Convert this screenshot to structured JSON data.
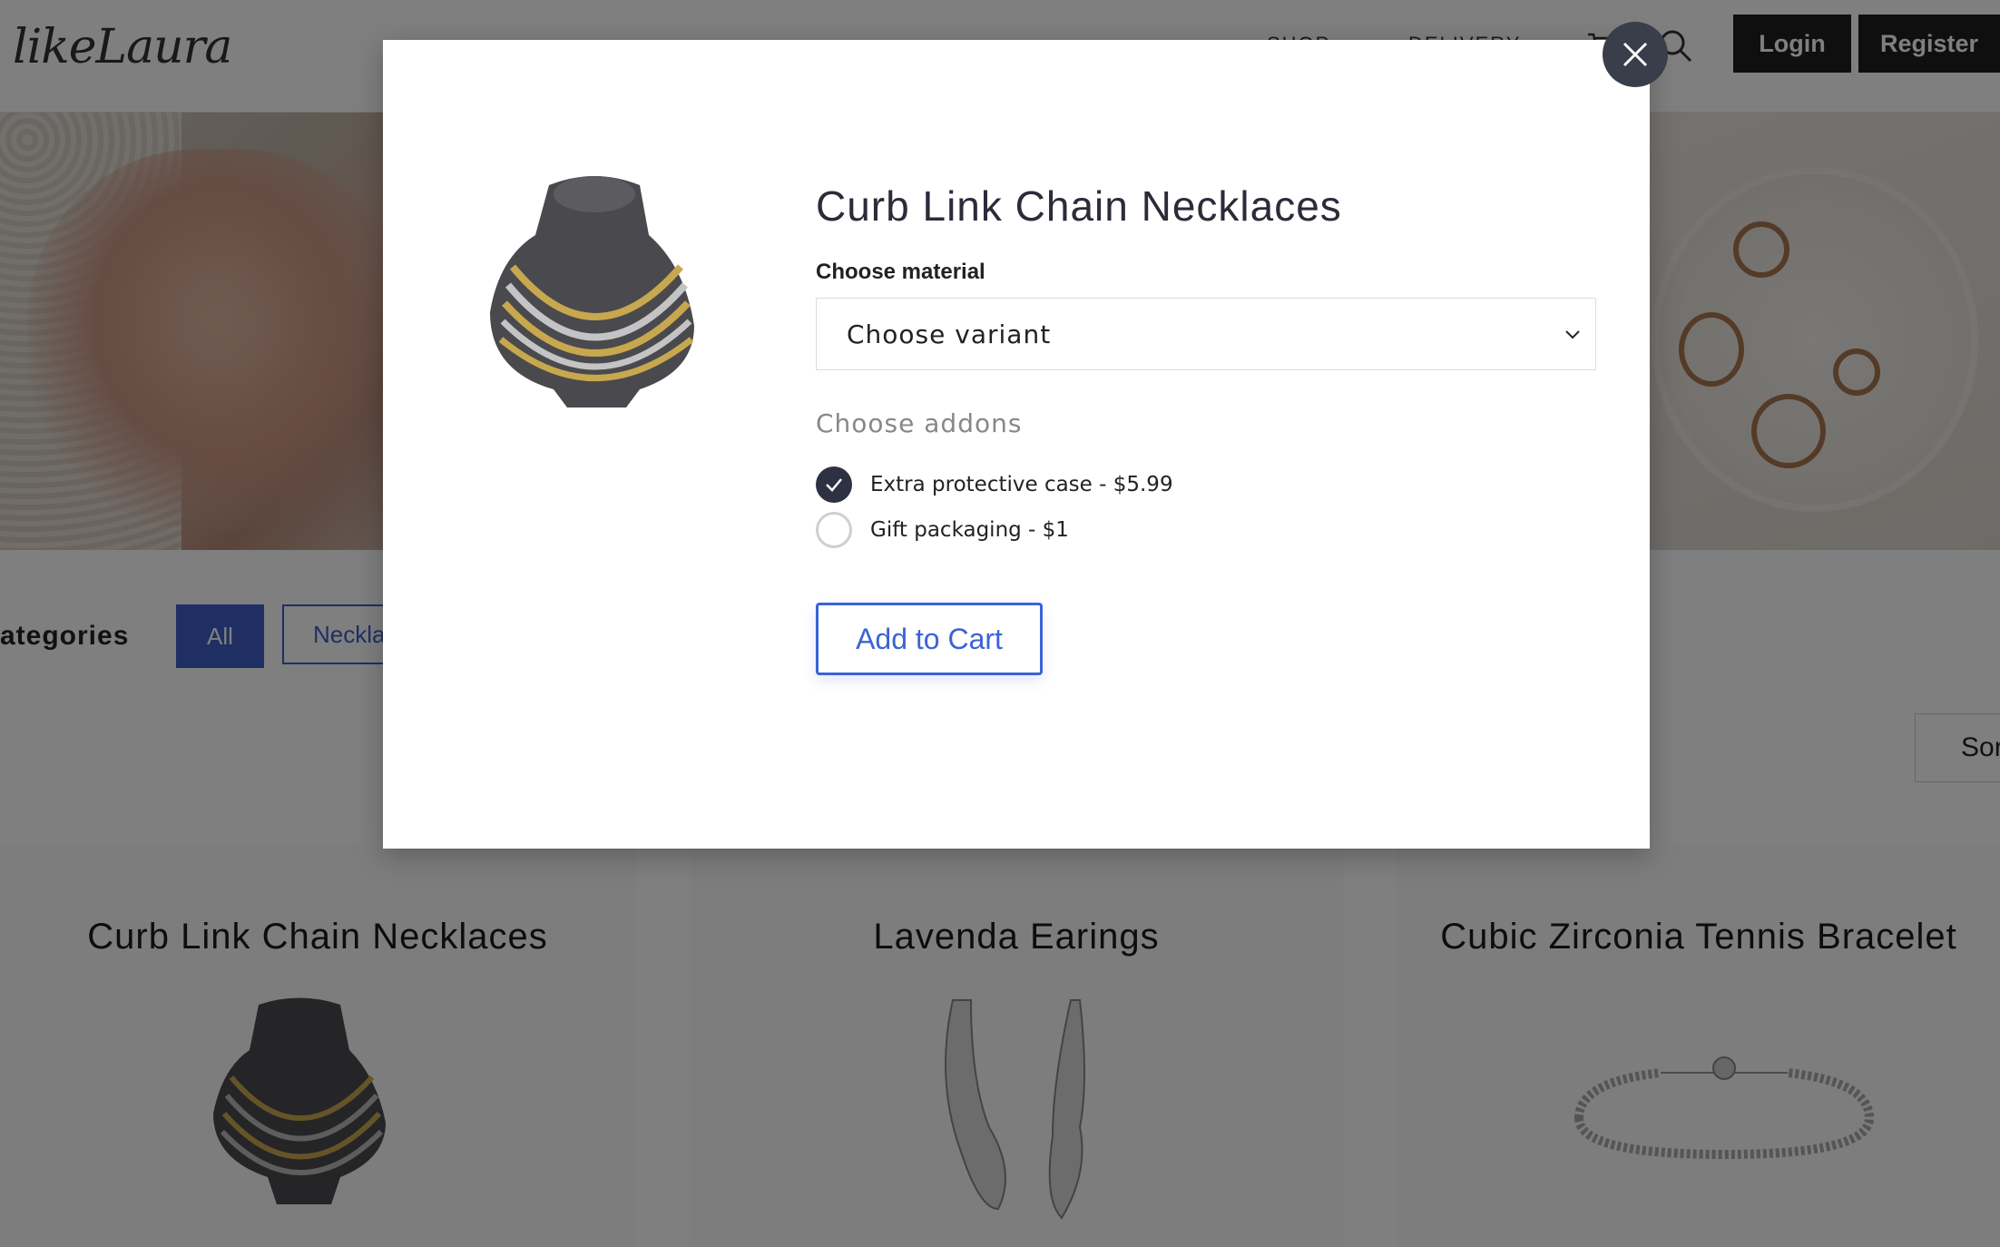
{
  "header": {
    "logo": "likeLaura",
    "nav": [
      "SHOP",
      "DELIVERY"
    ],
    "login_label": "Login",
    "register_label": "Register"
  },
  "categories": {
    "label": "ategories",
    "all_label": "All",
    "necklaces_label": "Neckla"
  },
  "sort": {
    "label": "Sor"
  },
  "products": [
    {
      "title": "Curb Link Chain Necklaces"
    },
    {
      "title": "Lavenda Earings"
    },
    {
      "title": "Cubic Zirconia Tennis Bracelet"
    }
  ],
  "modal": {
    "title": "Curb Link Chain Necklaces",
    "material_label": "Choose material",
    "variant_placeholder": "Choose variant",
    "addons_label": "Choose addons",
    "addons": [
      {
        "label": "Extra protective case - $5.99",
        "checked": true
      },
      {
        "label": "Gift packaging - $1",
        "checked": false
      }
    ],
    "add_to_cart": "Add to Cart"
  },
  "colors": {
    "accent": "#3a63d6",
    "category_active": "#3f5ec9",
    "close_button": "#3a3d4a",
    "header_buttons": "#1e1e1e"
  }
}
